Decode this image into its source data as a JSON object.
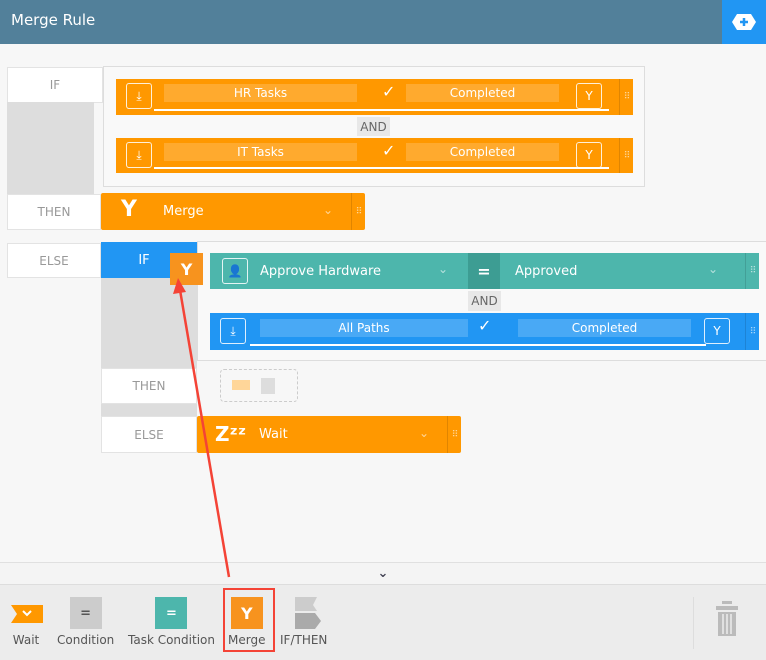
{
  "header": {
    "title": "Merge Rule",
    "add_icon": "add-icon"
  },
  "rule": {
    "if_label": "IF",
    "then_label": "THEN",
    "else_label": "ELSE",
    "conditions": [
      {
        "name": "HR Tasks",
        "status": "Completed"
      },
      {
        "name": "IT Tasks",
        "status": "Completed"
      }
    ],
    "and_label": "AND",
    "then_action": "Merge",
    "else_rule": {
      "if_label": "IF",
      "then_label": "THEN",
      "else_label": "ELSE",
      "and_label": "AND",
      "task_condition": {
        "task": "Approve Hardware",
        "operator": "=",
        "value": "Approved"
      },
      "path_condition": {
        "name": "All Paths",
        "status": "Completed"
      },
      "else_action": "Wait"
    }
  },
  "toolbar": {
    "items": [
      {
        "label": "Wait"
      },
      {
        "label": "Condition"
      },
      {
        "label": "Task Condition"
      },
      {
        "label": "Merge"
      },
      {
        "label": "IF/THEN"
      }
    ]
  },
  "colors": {
    "header": "#52809a",
    "orange": "#ff9800",
    "teal": "#4db6ac",
    "blue": "#2196f3",
    "highlight": "#f44336"
  }
}
